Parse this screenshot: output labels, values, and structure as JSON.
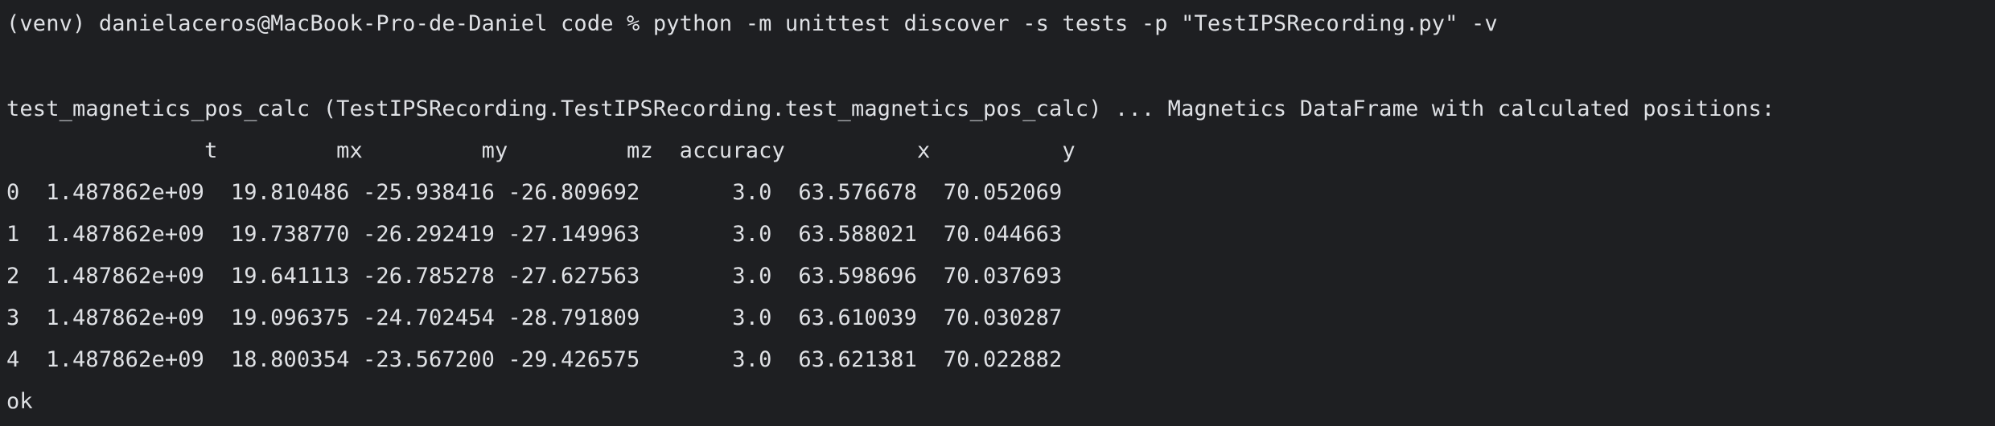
{
  "terminal": {
    "command_line": "(venv) danielaceros@MacBook-Pro-de-Daniel code % python -m unittest discover -s tests -p \"TestIPSRecording.py\" -v",
    "test_line": "test_magnetics_pos_calc (TestIPSRecording.TestIPSRecording.test_magnetics_pos_calc) ... Magnetics DataFrame with calculated positions:",
    "table": {
      "columns": [
        "t",
        "mx",
        "my",
        "mz",
        "accuracy",
        "x",
        "y"
      ],
      "header_line": "               t         mx         my         mz  accuracy          x          y",
      "rows": [
        {
          "index": "0",
          "t": "1.487862e+09",
          "mx": "19.810486",
          "my": "-25.938416",
          "mz": "-26.809692",
          "accuracy": "3.0",
          "x": "63.576678",
          "y": "70.052069"
        },
        {
          "index": "1",
          "t": "1.487862e+09",
          "mx": "19.738770",
          "my": "-26.292419",
          "mz": "-27.149963",
          "accuracy": "3.0",
          "x": "63.588021",
          "y": "70.044663"
        },
        {
          "index": "2",
          "t": "1.487862e+09",
          "mx": "19.641113",
          "my": "-26.785278",
          "mz": "-27.627563",
          "accuracy": "3.0",
          "x": "63.598696",
          "y": "70.037693"
        },
        {
          "index": "3",
          "t": "1.487862e+09",
          "mx": "19.096375",
          "my": "-24.702454",
          "mz": "-28.791809",
          "accuracy": "3.0",
          "x": "63.610039",
          "y": "70.030287"
        },
        {
          "index": "4",
          "t": "1.487862e+09",
          "mx": "18.800354",
          "my": "-23.567200",
          "mz": "-29.426575",
          "accuracy": "3.0",
          "x": "63.621381",
          "y": "70.022882"
        }
      ],
      "row_lines": [
        "0  1.487862e+09  19.810486 -25.938416 -26.809692       3.0  63.576678  70.052069",
        "1  1.487862e+09  19.738770 -26.292419 -27.149963       3.0  63.588021  70.044663",
        "2  1.487862e+09  19.641113 -26.785278 -27.627563       3.0  63.598696  70.037693",
        "3  1.487862e+09  19.096375 -24.702454 -28.791809       3.0  63.610039  70.030287",
        "4  1.487862e+09  18.800354 -23.567200 -29.426575       3.0  63.621381  70.022882"
      ]
    },
    "status_line": "ok",
    "colors": {
      "background": "#1e1f22",
      "text": "#dfe1e5"
    }
  }
}
